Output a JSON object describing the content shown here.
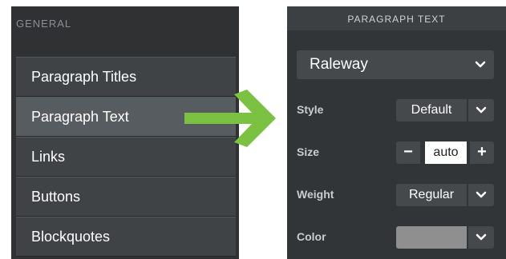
{
  "left": {
    "heading": "GENERAL",
    "items": [
      {
        "label": "Paragraph Titles"
      },
      {
        "label": "Paragraph Text"
      },
      {
        "label": "Links"
      },
      {
        "label": "Buttons"
      },
      {
        "label": "Blockquotes"
      }
    ],
    "active_index": 1
  },
  "right": {
    "header": "PARAGRAPH TEXT",
    "font": {
      "value": "Raleway"
    },
    "style": {
      "label": "Style",
      "value": "Default"
    },
    "size": {
      "label": "Size",
      "value": "auto",
      "minus": "−",
      "plus": "+"
    },
    "weight": {
      "label": "Weight",
      "value": "Regular"
    },
    "color": {
      "label": "Color",
      "swatch": "#8f8f8f"
    }
  },
  "colors": {
    "arrow": "#7cc242",
    "accent": "#575c60"
  }
}
